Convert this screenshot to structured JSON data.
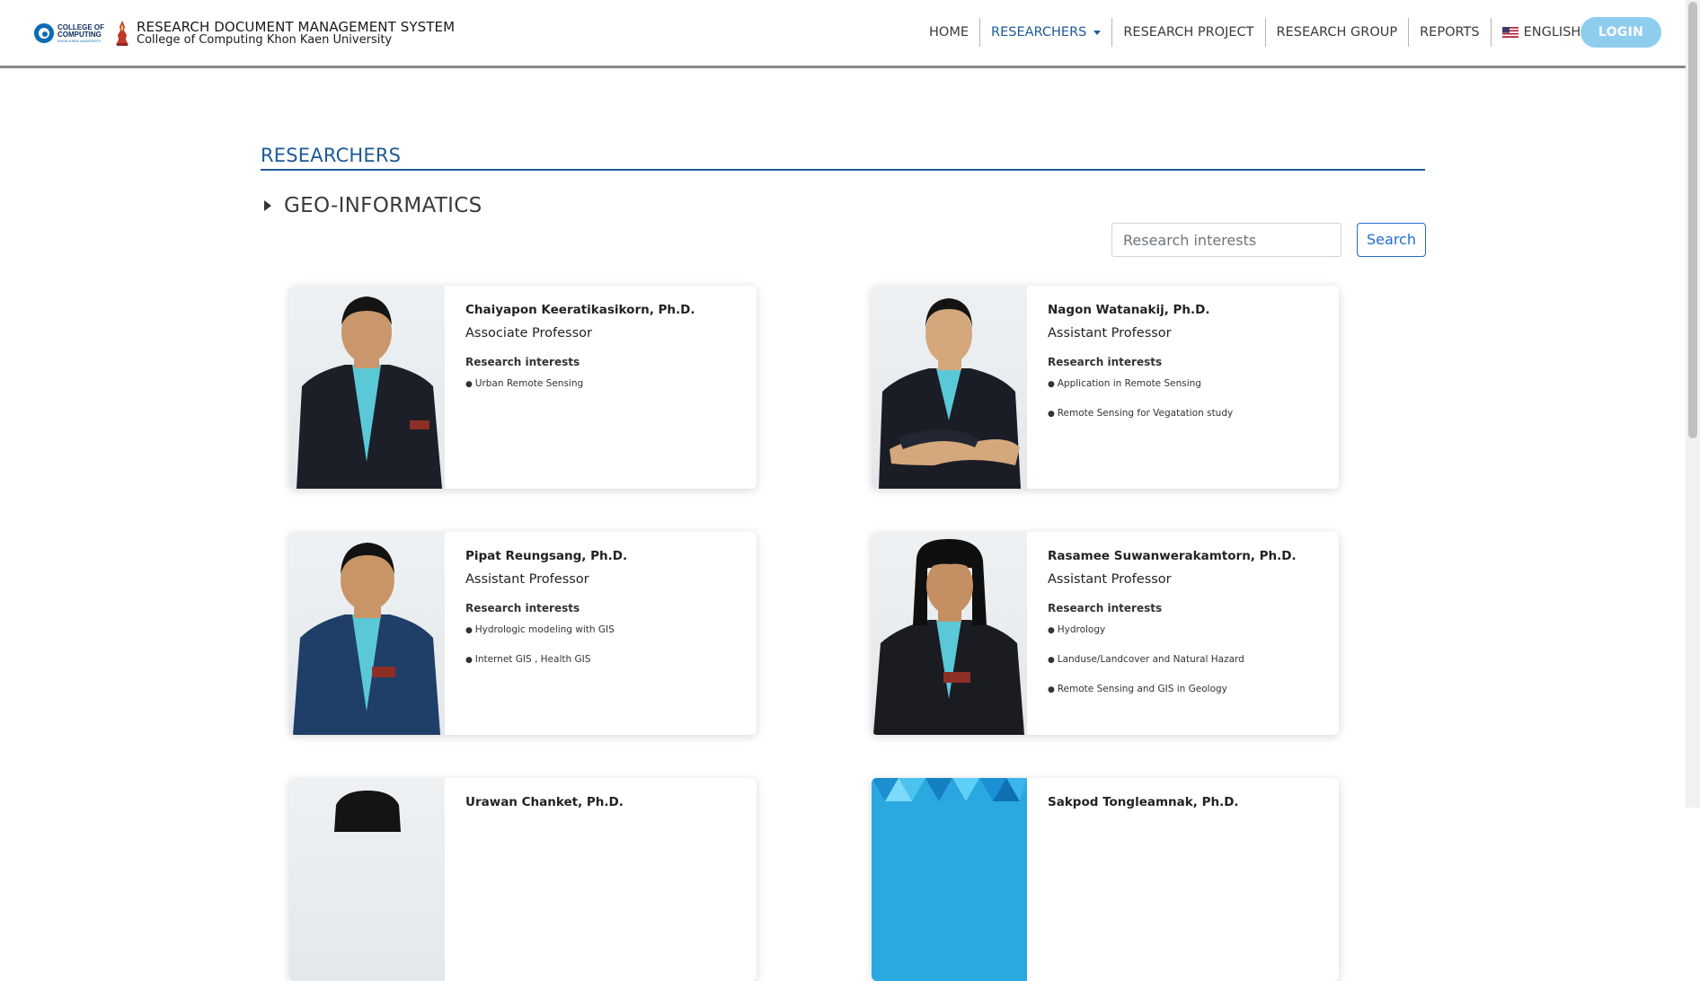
{
  "header": {
    "logo_word_top": "COLLEGE OF",
    "logo_word_bottom": "COMPUTING",
    "logo_word_sub": "KHON KAEN UNIVERSITY",
    "title": "RESEARCH DOCUMENT MANAGEMENT SYSTEM",
    "subtitle": "College of Computing Khon Kaen University"
  },
  "nav": {
    "home": "HOME",
    "researchers": "RESEARCHERS",
    "research_project": "RESEARCH PROJECT",
    "research_group": "RESEARCH GROUP",
    "reports": "REPORTS",
    "language": "ENGLISH",
    "login": "LOGIN"
  },
  "page": {
    "heading": "RESEARCHERS",
    "section_title": "GEO-INFORMATICS",
    "search_placeholder": "Research interests",
    "search_button": "Search"
  },
  "researchers": [
    {
      "name": "Chaiyapon Keeratikasikorn, Ph.D.",
      "position": "Associate Professor",
      "interests_label": "Research interests",
      "interests": [
        "Urban Remote Sensing"
      ]
    },
    {
      "name": "Nagon Watanakij, Ph.D.",
      "position": "Assistant Professor",
      "interests_label": "Research interests",
      "interests": [
        "Application in Remote Sensing",
        "Remote Sensing for Vegatation study"
      ]
    },
    {
      "name": "Pipat Reungsang, Ph.D.",
      "position": "Assistant Professor",
      "interests_label": "Research interests",
      "interests": [
        "Hydrologic modeling with GIS",
        "Internet GIS , Health GIS"
      ]
    },
    {
      "name": "Rasamee Suwanwerakamtorn, Ph.D.",
      "position": "Assistant Professor",
      "interests_label": "Research interests",
      "interests": [
        "Hydrology",
        "Landuse/Landcover and Natural Hazard",
        "Remote Sensing and GIS in Geology"
      ]
    },
    {
      "name": "Urawan Chanket, Ph.D."
    },
    {
      "name": "Sakpod Tongleamnak, Ph.D."
    }
  ],
  "colors": {
    "accent": "#1e5a96",
    "login_bg": "#8fcdee",
    "search_border": "#1e6fd0"
  }
}
